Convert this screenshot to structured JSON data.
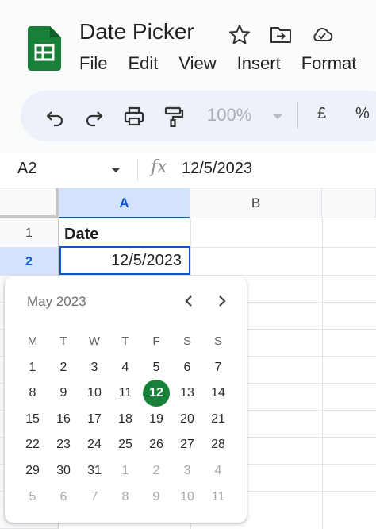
{
  "app": {
    "title": "Date Picker",
    "menu": [
      "File",
      "Edit",
      "View",
      "Insert",
      "Format"
    ],
    "brand_color": "#188038"
  },
  "toolbar": {
    "undo_icon": "undo-icon",
    "redo_icon": "redo-icon",
    "print_icon": "print-icon",
    "paint_format_icon": "paint-format-icon",
    "zoom_value": "100%",
    "currency_label": "£",
    "percent_label": "%"
  },
  "formula_bar": {
    "cell_ref": "A2",
    "fx_label": "fx",
    "value": "12/5/2023"
  },
  "sheet": {
    "columns": [
      "A",
      "B"
    ],
    "rows": [
      "1",
      "2"
    ],
    "cells": {
      "A1": "Date",
      "A2": "12/5/2023"
    },
    "selection_color": "#0b57d0"
  },
  "date_picker": {
    "month_label": "May 2023",
    "weekdays": [
      "M",
      "T",
      "W",
      "T",
      "F",
      "S",
      "S"
    ],
    "weeks": [
      [
        {
          "d": "1"
        },
        {
          "d": "2"
        },
        {
          "d": "3"
        },
        {
          "d": "4"
        },
        {
          "d": "5"
        },
        {
          "d": "6"
        },
        {
          "d": "7"
        }
      ],
      [
        {
          "d": "8"
        },
        {
          "d": "9"
        },
        {
          "d": "10"
        },
        {
          "d": "11"
        },
        {
          "d": "12",
          "selected": true
        },
        {
          "d": "13"
        },
        {
          "d": "14"
        }
      ],
      [
        {
          "d": "15"
        },
        {
          "d": "16"
        },
        {
          "d": "17"
        },
        {
          "d": "18"
        },
        {
          "d": "19"
        },
        {
          "d": "20"
        },
        {
          "d": "21"
        }
      ],
      [
        {
          "d": "22"
        },
        {
          "d": "23"
        },
        {
          "d": "24"
        },
        {
          "d": "25"
        },
        {
          "d": "26"
        },
        {
          "d": "27"
        },
        {
          "d": "28"
        }
      ],
      [
        {
          "d": "29"
        },
        {
          "d": "30"
        },
        {
          "d": "31"
        },
        {
          "d": "1",
          "out": true
        },
        {
          "d": "2",
          "out": true
        },
        {
          "d": "3",
          "out": true
        },
        {
          "d": "4",
          "out": true
        }
      ],
      [
        {
          "d": "5",
          "out": true
        },
        {
          "d": "6",
          "out": true
        },
        {
          "d": "7",
          "out": true
        },
        {
          "d": "8",
          "out": true
        },
        {
          "d": "9",
          "out": true
        },
        {
          "d": "10",
          "out": true
        },
        {
          "d": "11",
          "out": true
        }
      ]
    ],
    "selected_color": "#188038"
  }
}
